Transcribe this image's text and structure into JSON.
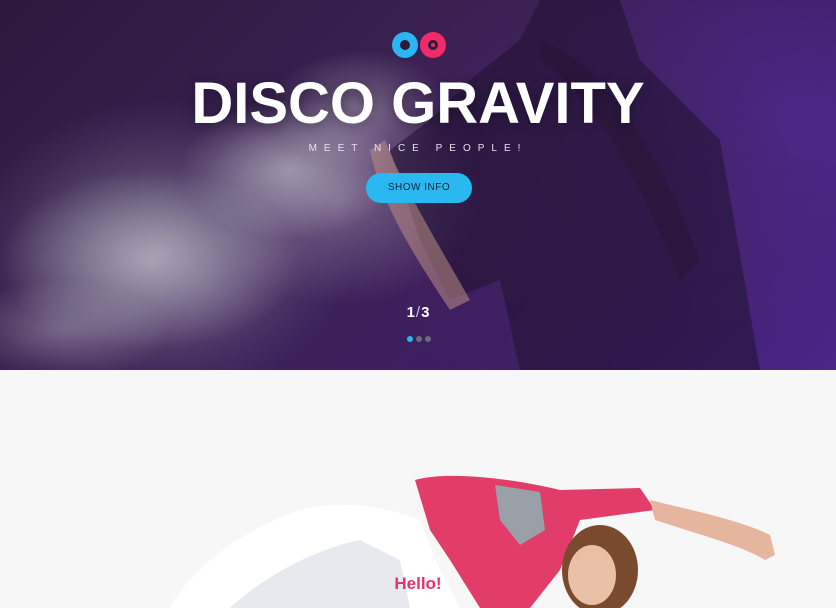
{
  "hero": {
    "title": "DISCO GRAVITY",
    "subtitle": "MEET NICE PEOPLE!",
    "button_label": "SHOW INFO",
    "slide_current": "1",
    "slide_separator": "/",
    "slide_total": "3",
    "dots_count": 3,
    "active_dot": 1
  },
  "logo": {
    "icon": "vinyl-records-icon",
    "left_color": "#2ab6f2",
    "right_color": "#f02b68"
  },
  "lower": {
    "heading": "Hello!"
  },
  "colors": {
    "accent_blue": "#2ab8f0",
    "accent_pink": "#e8316a",
    "hero_bg": "#3a2152"
  }
}
